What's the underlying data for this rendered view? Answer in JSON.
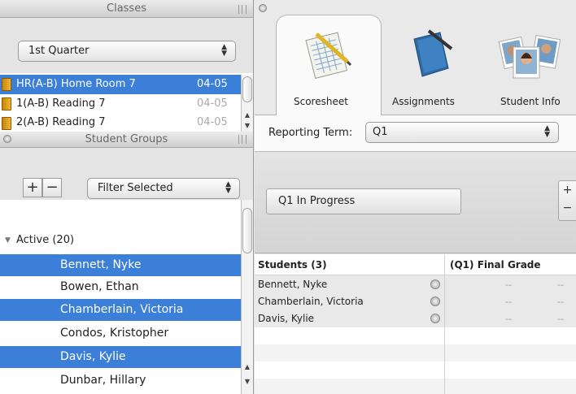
{
  "classes_panel": {
    "title": "Classes",
    "quarter_select": "1st Quarter",
    "classes": [
      {
        "name": "HR(A-B) Home Room 7",
        "date": "04-05",
        "selected": true
      },
      {
        "name": "1(A-B) Reading 7",
        "date": "04-05",
        "selected": false
      },
      {
        "name": "2(A-B) Reading 7",
        "date": "04-05",
        "selected": false
      }
    ]
  },
  "groups_panel": {
    "title": "Student Groups",
    "add_label": "+",
    "remove_label": "−",
    "filter_select": "Filter Selected",
    "group_label": "Active (20)",
    "students": [
      {
        "name": "Bennett, Nyke",
        "selected": true
      },
      {
        "name": "Bowen, Ethan",
        "selected": false
      },
      {
        "name": "Chamberlain, Victoria",
        "selected": true
      },
      {
        "name": "Condos, Kristopher",
        "selected": false
      },
      {
        "name": "Davis, Kylie",
        "selected": true
      },
      {
        "name": "Dunbar, Hillary",
        "selected": false
      }
    ]
  },
  "tabs": [
    {
      "label": "Scoresheet",
      "icon": "scoresheet-icon",
      "active": true
    },
    {
      "label": "Assignments",
      "icon": "assignments-icon",
      "active": false
    },
    {
      "label": "Student Info",
      "icon": "student-info-icon",
      "active": false
    }
  ],
  "reporting_term": {
    "label": "Reporting Term:",
    "value": "Q1"
  },
  "progress_button": "Q1 In Progress",
  "table": {
    "col_students": "Students (3)",
    "col_grade": "(Q1) Final Grade",
    "rows": [
      {
        "name": "Bennett, Nyke",
        "v1": "--",
        "v2": "--"
      },
      {
        "name": "Chamberlain, Victoria",
        "v1": "--",
        "v2": "--"
      },
      {
        "name": "Davis, Kylie",
        "v1": "--",
        "v2": "--"
      }
    ]
  },
  "colors": {
    "selection": "#3b7fd9",
    "book": "#e6a21e"
  }
}
